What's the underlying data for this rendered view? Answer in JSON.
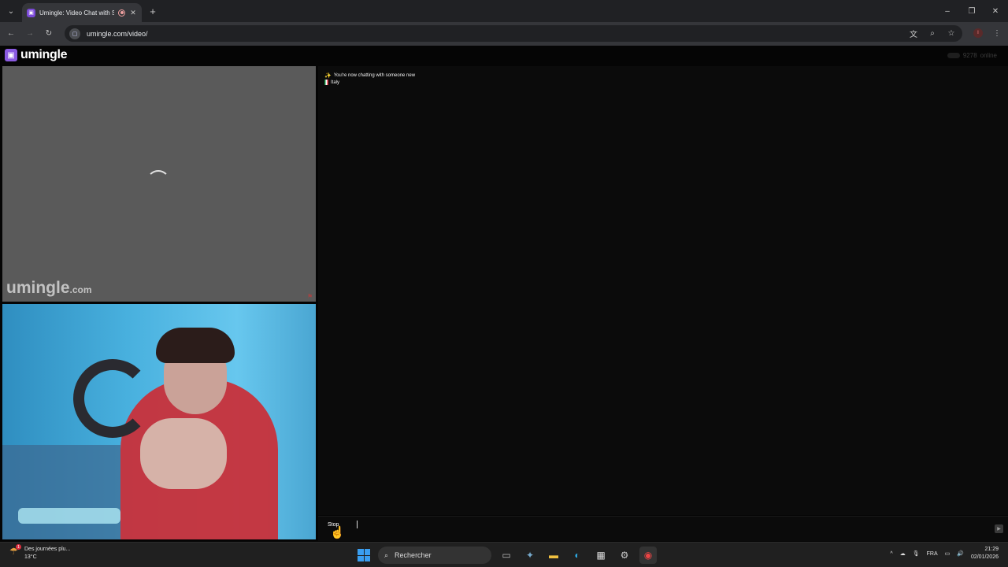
{
  "browser": {
    "tab_title": "Umingle: Video Chat with S",
    "new_tab": "+",
    "url": "umingle.com/video/",
    "window_controls": {
      "minimize": "–",
      "restore": "❐",
      "close": "✕"
    }
  },
  "page": {
    "logo": "umingle",
    "online_count": "9278",
    "online_label": "online",
    "watermark_main": "umingle",
    "watermark_suffix": ".com",
    "chat": {
      "system_message": "You're now chatting with someone new",
      "country": "Italy"
    },
    "stop_label": "Stop"
  },
  "taskbar": {
    "weather_text": "Des journées plu...",
    "weather_temp": "13°C",
    "weather_badge": "1",
    "search_label": "Rechercher",
    "language": "FRA",
    "time": "21:29",
    "date": "02/01/2026"
  },
  "colors": {
    "brand": "#8a5ae0",
    "chrome_dark": "#202124",
    "taskbar": "#202020"
  },
  "icons": {
    "tab_search": "chevron-down-icon",
    "back": "arrow-left-icon",
    "forward": "arrow-right-icon",
    "reload": "reload-icon",
    "translate": "translate-icon",
    "zoom": "zoom-icon",
    "bookmark": "star-icon",
    "menu": "kebab-menu-icon"
  }
}
